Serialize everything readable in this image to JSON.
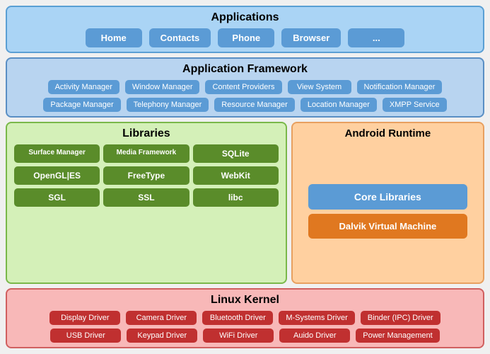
{
  "applications": {
    "title": "Applications",
    "buttons": [
      "Home",
      "Contacts",
      "Phone",
      "Browser",
      "..."
    ]
  },
  "appFramework": {
    "title": "Application Framework",
    "row1": [
      {
        "label": "Activity Manager"
      },
      {
        "label": "Window Manager"
      },
      {
        "label": "Content Providers"
      },
      {
        "label": "View System"
      },
      {
        "label": "Notification Manager"
      }
    ],
    "row2": [
      {
        "label": "Package Manager"
      },
      {
        "label": "Telephony Manager"
      },
      {
        "label": "Resource Manager"
      },
      {
        "label": "Location Manager"
      },
      {
        "label": "XMPP Service"
      }
    ]
  },
  "libraries": {
    "title": "Libraries",
    "items": [
      {
        "label": "Surface Manager"
      },
      {
        "label": "Media Framework"
      },
      {
        "label": "SQLite"
      },
      {
        "label": "OpenGL|ES"
      },
      {
        "label": "FreeType"
      },
      {
        "label": "WebKit"
      },
      {
        "label": "SGL"
      },
      {
        "label": "SSL"
      },
      {
        "label": "libc"
      }
    ]
  },
  "androidRuntime": {
    "title": "Android Runtime",
    "coreLibraries": "Core Libraries",
    "dalvikVM": "Dalvik Virtual Machine"
  },
  "linuxKernel": {
    "title": "Linux Kernel",
    "row1": [
      {
        "label": "Display Driver"
      },
      {
        "label": "Camera Driver"
      },
      {
        "label": "Bluetooth Driver"
      },
      {
        "label": "M-Systems Driver"
      },
      {
        "label": "Binder (IPC) Driver"
      }
    ],
    "row2": [
      {
        "label": "USB Driver"
      },
      {
        "label": "Keypad Driver"
      },
      {
        "label": "WiFi Driver"
      },
      {
        "label": "Auido Driver"
      },
      {
        "label": "Power Management"
      }
    ]
  }
}
